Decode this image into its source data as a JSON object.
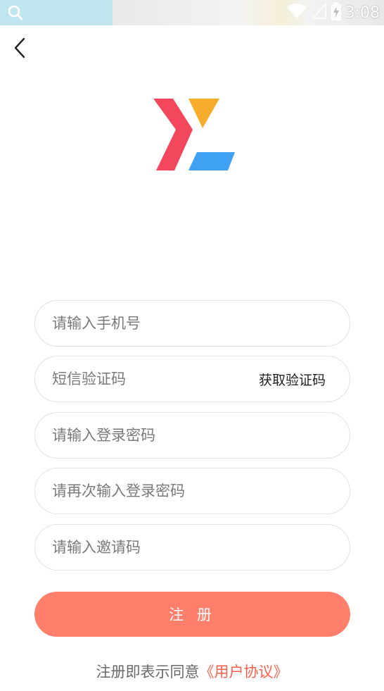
{
  "status_bar": {
    "time": "3:08"
  },
  "form": {
    "phone_placeholder": "请输入手机号",
    "sms_placeholder": "短信验证码",
    "get_code_label": "获取验证码",
    "password_placeholder": "请输入登录密码",
    "confirm_password_placeholder": "请再次输入登录密码",
    "invite_placeholder": "请输入邀请码",
    "register_label": "注 册"
  },
  "agreement": {
    "prefix": "注册即表示同意",
    "link": "《用户协议》"
  },
  "colors": {
    "accent": "#ff7f6a",
    "link": "#ff5f4a",
    "logo_red": "#f2475c",
    "logo_yellow": "#f7ad2c",
    "logo_blue": "#3ea1f4"
  }
}
